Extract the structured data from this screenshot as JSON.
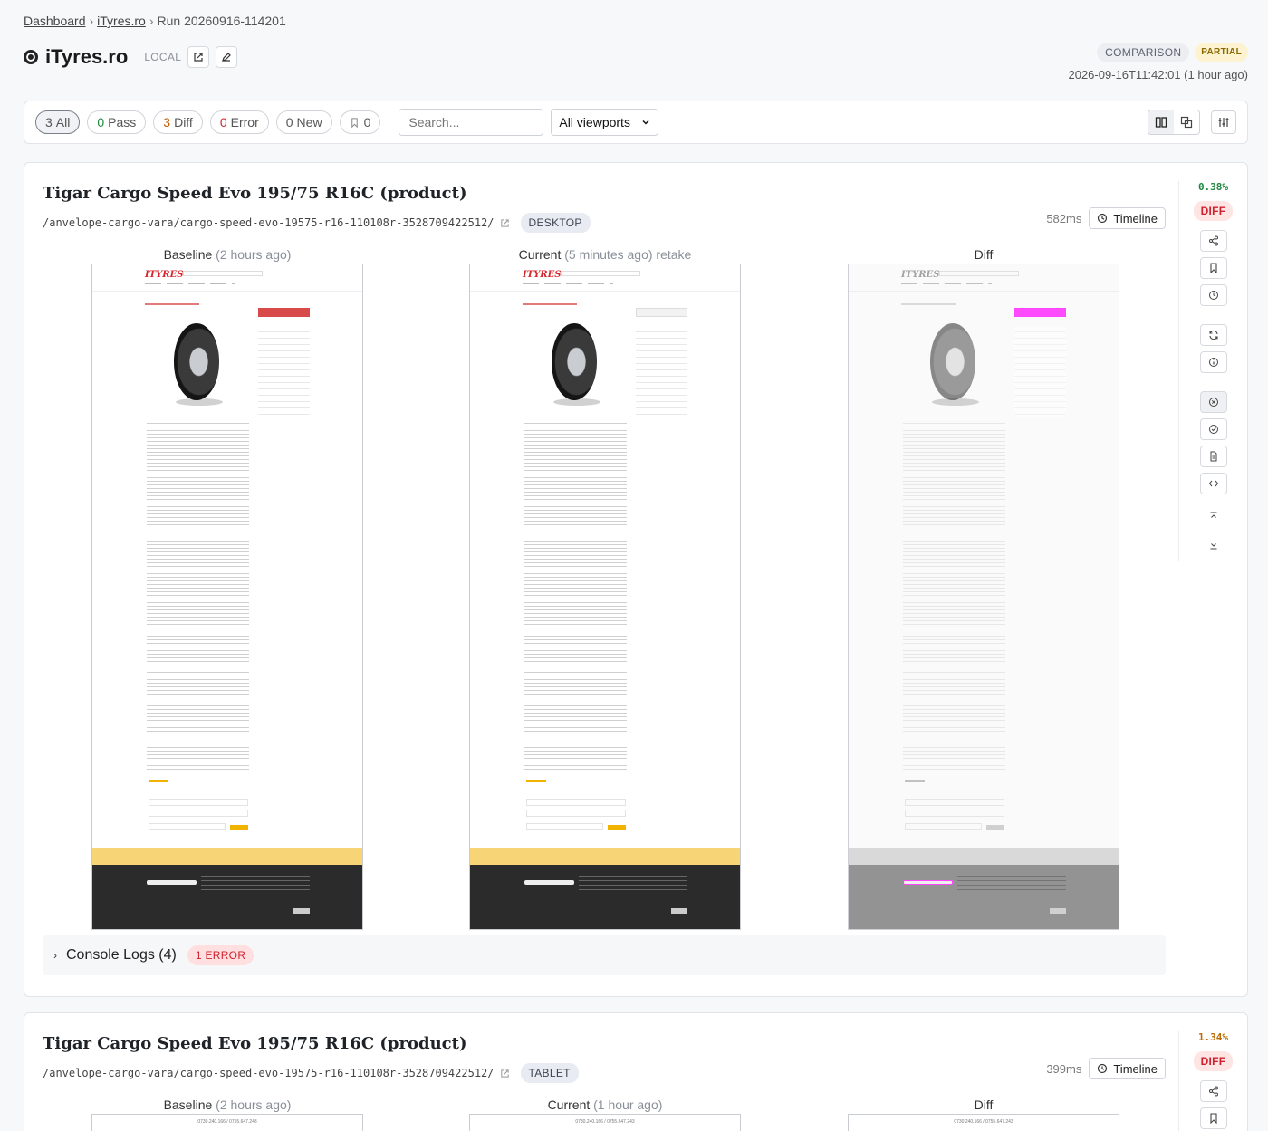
{
  "breadcrumb": {
    "home": "Dashboard",
    "site": "iTyres.ro",
    "current": "Run 20260916-114201"
  },
  "header": {
    "title": "iTyres.ro",
    "env": "LOCAL",
    "badge_type": "COMPARISON",
    "badge_status": "PARTIAL",
    "timestamp": "2026-09-16T11:42:01 (1 hour ago)"
  },
  "filters": {
    "all": {
      "count": "3",
      "label": "All"
    },
    "pass": {
      "count": "0",
      "label": "Pass"
    },
    "diff": {
      "count": "3",
      "label": "Diff"
    },
    "error": {
      "count": "0",
      "label": "Error"
    },
    "new": {
      "count": "0",
      "label": "New"
    },
    "bookmarked": {
      "count": "0"
    },
    "search_placeholder": "Search...",
    "viewport_selected": "All viewports"
  },
  "results": [
    {
      "title": "Tigar Cargo Speed Evo 195/75 R16C (product)",
      "path": "/anvelope-cargo-vara/cargo-speed-evo-19575-r16-110108r-3528709422512/",
      "viewport": "DESKTOP",
      "duration": "582ms",
      "timeline_label": "Timeline",
      "diff_percent": "0.38%",
      "status": "DIFF",
      "baseline_label": "Baseline",
      "baseline_age": "(2 hours ago)",
      "current_label": "Current",
      "current_age": "(5 minutes ago) retake",
      "diff_label": "Diff",
      "console_label": "Console Logs (4)",
      "console_badge": "1 ERROR"
    },
    {
      "title": "Tigar Cargo Speed Evo 195/75 R16C (product)",
      "path": "/anvelope-cargo-vara/cargo-speed-evo-19575-r16-110108r-3528709422512/",
      "viewport": "TABLET",
      "duration": "399ms",
      "timeline_label": "Timeline",
      "diff_percent": "1.34%",
      "status": "DIFF",
      "baseline_label": "Baseline",
      "baseline_age": "(2 hours ago)",
      "current_label": "Current",
      "current_age": "(1 hour ago)",
      "diff_label": "Diff",
      "tablet_topbar": "0730.240.166 / 0755.647.243"
    }
  ],
  "screenshot": {
    "logo": "ITYRES"
  },
  "icons": [
    "tyre-icon",
    "external-link-icon",
    "edit-icon",
    "side-by-side-icon",
    "overlay-icon",
    "settings-icon",
    "history-icon",
    "share-icon",
    "bookmark-icon",
    "refresh-icon",
    "info-icon",
    "reject-icon",
    "approve-icon",
    "document-icon",
    "code-icon",
    "scroll-top-icon",
    "scroll-bottom-icon"
  ]
}
